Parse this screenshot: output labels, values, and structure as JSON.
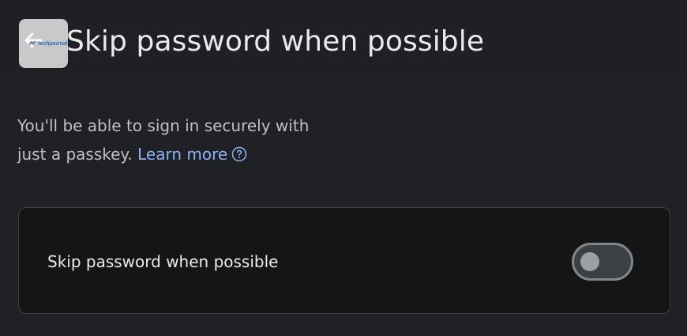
{
  "header": {
    "title": "Skip password when possible",
    "back_icon": "arrow-left-icon",
    "watermark_text": "techjournal"
  },
  "description": {
    "line1": "You'll be able to sign in securely with",
    "line2_prefix": "just a passkey.",
    "learn_more_label": "Learn more",
    "help_icon": "help-circle-icon"
  },
  "setting": {
    "label": "Skip password when possible",
    "toggle_on": false
  },
  "colors": {
    "background": "#202124",
    "card_background": "#151516",
    "link": "#8ab4f8",
    "title_text": "#e8eaed",
    "body_text": "#bdc1c6"
  }
}
